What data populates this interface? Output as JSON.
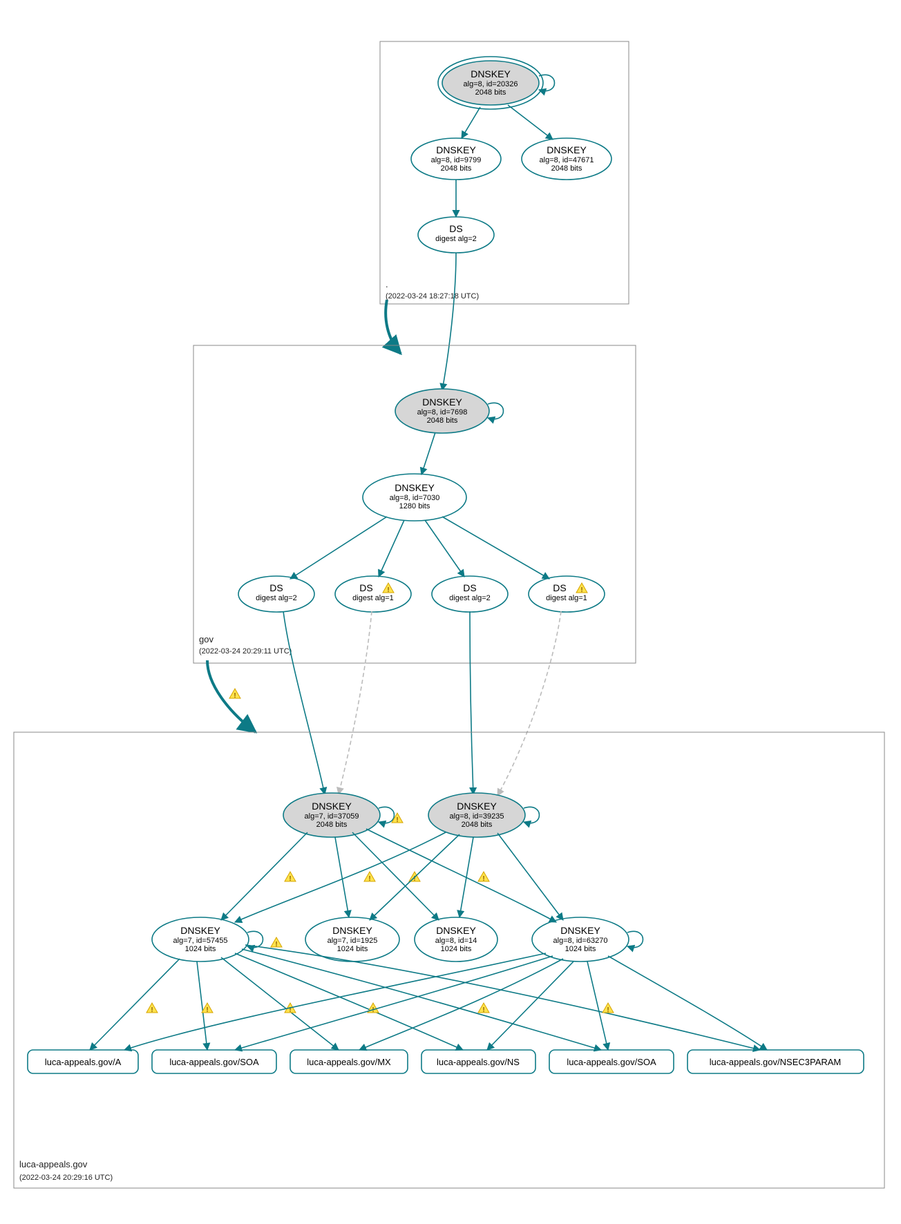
{
  "zones": {
    "root": {
      "name": ".",
      "timestamp": "(2022-03-24 18:27:18 UTC)"
    },
    "gov": {
      "name": "gov",
      "timestamp": "(2022-03-24 20:29:11 UTC)"
    },
    "luca": {
      "name": "luca-appeals.gov",
      "timestamp": "(2022-03-24 20:29:16 UTC)"
    }
  },
  "nodes": {
    "root_ksk": {
      "title": "DNSKEY",
      "line2": "alg=8, id=20326",
      "line3": "2048 bits"
    },
    "root_zsk1": {
      "title": "DNSKEY",
      "line2": "alg=8, id=9799",
      "line3": "2048 bits"
    },
    "root_zsk2": {
      "title": "DNSKEY",
      "line2": "alg=8, id=47671",
      "line3": "2048 bits"
    },
    "root_ds": {
      "title": "DS",
      "line2": "digest alg=2",
      "line3": ""
    },
    "gov_ksk": {
      "title": "DNSKEY",
      "line2": "alg=8, id=7698",
      "line3": "2048 bits"
    },
    "gov_zsk": {
      "title": "DNSKEY",
      "line2": "alg=8, id=7030",
      "line3": "1280 bits"
    },
    "gov_ds1": {
      "title": "DS",
      "line2": "digest alg=2",
      "line3": ""
    },
    "gov_ds2": {
      "title": "DS",
      "line2": "digest alg=1",
      "line3": ""
    },
    "gov_ds3": {
      "title": "DS",
      "line2": "digest alg=2",
      "line3": ""
    },
    "gov_ds4": {
      "title": "DS",
      "line2": "digest alg=1",
      "line3": ""
    },
    "luca_ksk1": {
      "title": "DNSKEY",
      "line2": "alg=7, id=37059",
      "line3": "2048 bits"
    },
    "luca_ksk2": {
      "title": "DNSKEY",
      "line2": "alg=8, id=39235",
      "line3": "2048 bits"
    },
    "luca_zsk1": {
      "title": "DNSKEY",
      "line2": "alg=7, id=57455",
      "line3": "1024 bits"
    },
    "luca_zsk2": {
      "title": "DNSKEY",
      "line2": "alg=7, id=1925",
      "line3": "1024 bits"
    },
    "luca_zsk3": {
      "title": "DNSKEY",
      "line2": "alg=8, id=14",
      "line3": "1024 bits"
    },
    "luca_zsk4": {
      "title": "DNSKEY",
      "line2": "alg=8, id=63270",
      "line3": "1024 bits"
    }
  },
  "rrsets": {
    "a": "luca-appeals.gov/A",
    "soa1": "luca-appeals.gov/SOA",
    "mx": "luca-appeals.gov/MX",
    "ns": "luca-appeals.gov/NS",
    "soa2": "luca-appeals.gov/SOA",
    "n3p": "luca-appeals.gov/NSEC3PARAM"
  }
}
